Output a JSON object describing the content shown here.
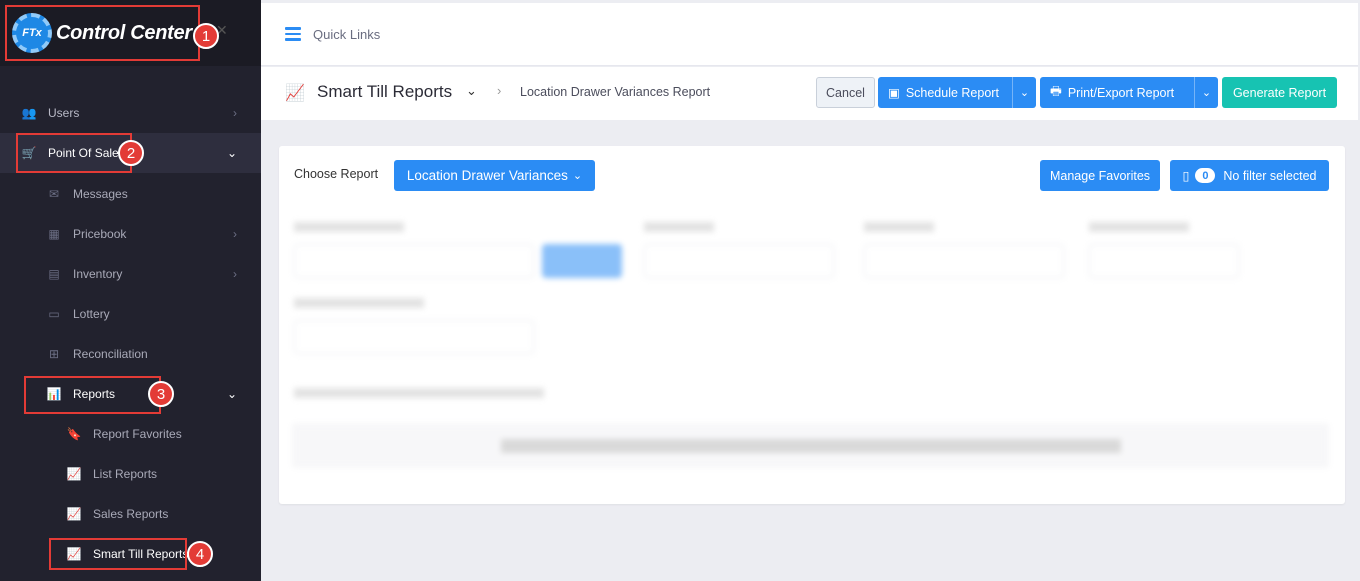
{
  "brand": {
    "logo_short": "FTx",
    "logo_text": "Control Center"
  },
  "sidebar": {
    "items": [
      {
        "label": "Users"
      },
      {
        "label": "Point Of Sale"
      },
      {
        "label": "Messages"
      },
      {
        "label": "Pricebook"
      },
      {
        "label": "Inventory"
      },
      {
        "label": "Lottery"
      },
      {
        "label": "Reconciliation"
      },
      {
        "label": "Reports"
      },
      {
        "label": "Report Favorites"
      },
      {
        "label": "List Reports"
      },
      {
        "label": "Sales Reports"
      },
      {
        "label": "Smart Till Reports"
      }
    ]
  },
  "annotations": [
    "1",
    "2",
    "3",
    "4"
  ],
  "topbar": {
    "quick_links": "Quick Links"
  },
  "header": {
    "title": "Smart Till Reports",
    "breadcrumb": "Location Drawer Variances Report",
    "cancel": "Cancel",
    "schedule": "Schedule Report",
    "print_export": "Print/Export Report",
    "generate": "Generate Report"
  },
  "report": {
    "choose_label": "Choose Report",
    "selected": "Location Drawer Variances",
    "manage_favorites": "Manage Favorites",
    "filter_count": "0",
    "filter_text": "No filter selected"
  },
  "colors": {
    "accent": "#2b8cf4",
    "teal": "#17c3b2",
    "annotation": "#e33b36",
    "sidebar": "#22222e"
  }
}
